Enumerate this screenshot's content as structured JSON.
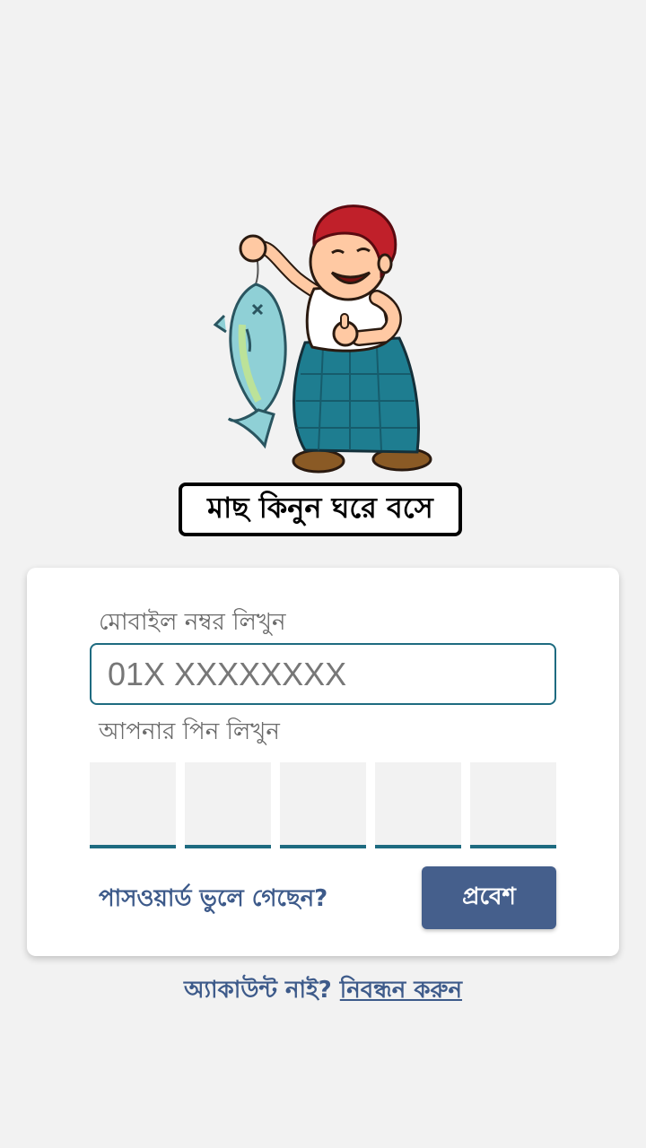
{
  "app": {
    "tagline": "মাছ কিনুন ঘরে বসে"
  },
  "login": {
    "mobile_label": "মোবাইল নম্বর লিখুন",
    "mobile_placeholder": "01X XXXXXXXX",
    "pin_label": "আপনার পিন লিখুন",
    "pin_boxes": [
      "",
      "",
      "",
      "",
      ""
    ],
    "forgot_link": "পাসওয়ার্ড ভুলে গেছেন?",
    "submit_label": "প্রবেশ"
  },
  "signup": {
    "prompt": "অ্যাকাউন্ট নাই?",
    "link": "নিবন্ধন করুন"
  },
  "colors": {
    "background": "#f2f2f2",
    "accent": "#1e6b80",
    "button": "#455f8c",
    "link": "#3d5a8a"
  }
}
